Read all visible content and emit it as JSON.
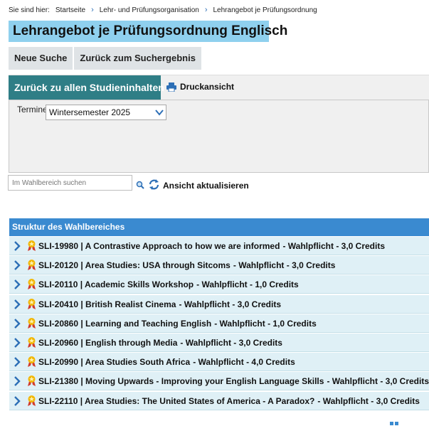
{
  "breadcrumb": {
    "prefix": "Sie sind hier:",
    "items": [
      "Startseite",
      "Lehr- und Prüfungsorganisation",
      "Lehrangebot je Prüfungsordnung"
    ]
  },
  "page_title": "Lehrangebot je Prüfungsordnung Englisch",
  "actions": {
    "new_search": "Neue Suche",
    "back_results": "Zurück zum Suchergebnis"
  },
  "panel": {
    "back_all": "Zurück zu allen Studieninhalten",
    "print": "Druckansicht",
    "term_label": "Termine",
    "term_value": "Wintersemester 2025"
  },
  "search": {
    "placeholder": "Im Wahlbereich suchen",
    "refresh_label": "Ansicht aktualisieren"
  },
  "structure": {
    "header": "Struktur des Wahlbereiches",
    "items": [
      {
        "title": "SLI-19980 | A Contrastive Approach to how we are informed",
        "meta": "- Wahlpflicht - 3,0 Credits"
      },
      {
        "title": "SLI-20120 | Area Studies: USA through Sitcoms",
        "meta": "- Wahlpflicht - 3,0 Credits"
      },
      {
        "title": "SLI-20110 | Academic Skills Workshop",
        "meta": "- Wahlpflicht - 1,0 Credits"
      },
      {
        "title": "SLI-20410 | British Realist Cinema",
        "meta": "- Wahlpflicht - 3,0 Credits"
      },
      {
        "title": "SLI-20860 | Learning and Teaching English",
        "meta": "- Wahlpflicht - 1,0 Credits"
      },
      {
        "title": "SLI-20960 | English through Media",
        "meta": "- Wahlpflicht - 3,0 Credits"
      },
      {
        "title": "SLI-20990 | Area Studies South Africa",
        "meta": "- Wahlpflicht - 4,0 Credits"
      },
      {
        "title": "SLI-21380 | Moving Upwards - Improving your English Language Skills",
        "meta": "- Wahlpflicht - 3,0 Credits"
      },
      {
        "title": "SLI-22110 | Area Studies: The United States of America - A Paradox?",
        "meta": "- Wahlpflicht - 3,0 Credits"
      }
    ]
  },
  "colors": {
    "title_bg": "#8fd0ee",
    "teal_button": "#2f7e86",
    "header_blue": "#3a8ad0",
    "row_bg": "#dff0f6",
    "chevron": "#2d6fb6"
  },
  "icons": {
    "breadcrumb_sep": "chevron-right-icon",
    "print": "printer-icon",
    "search": "magnifier-icon",
    "refresh": "refresh-icon",
    "row_expand": "chevron-right-icon",
    "row_badge": "award-icon"
  }
}
